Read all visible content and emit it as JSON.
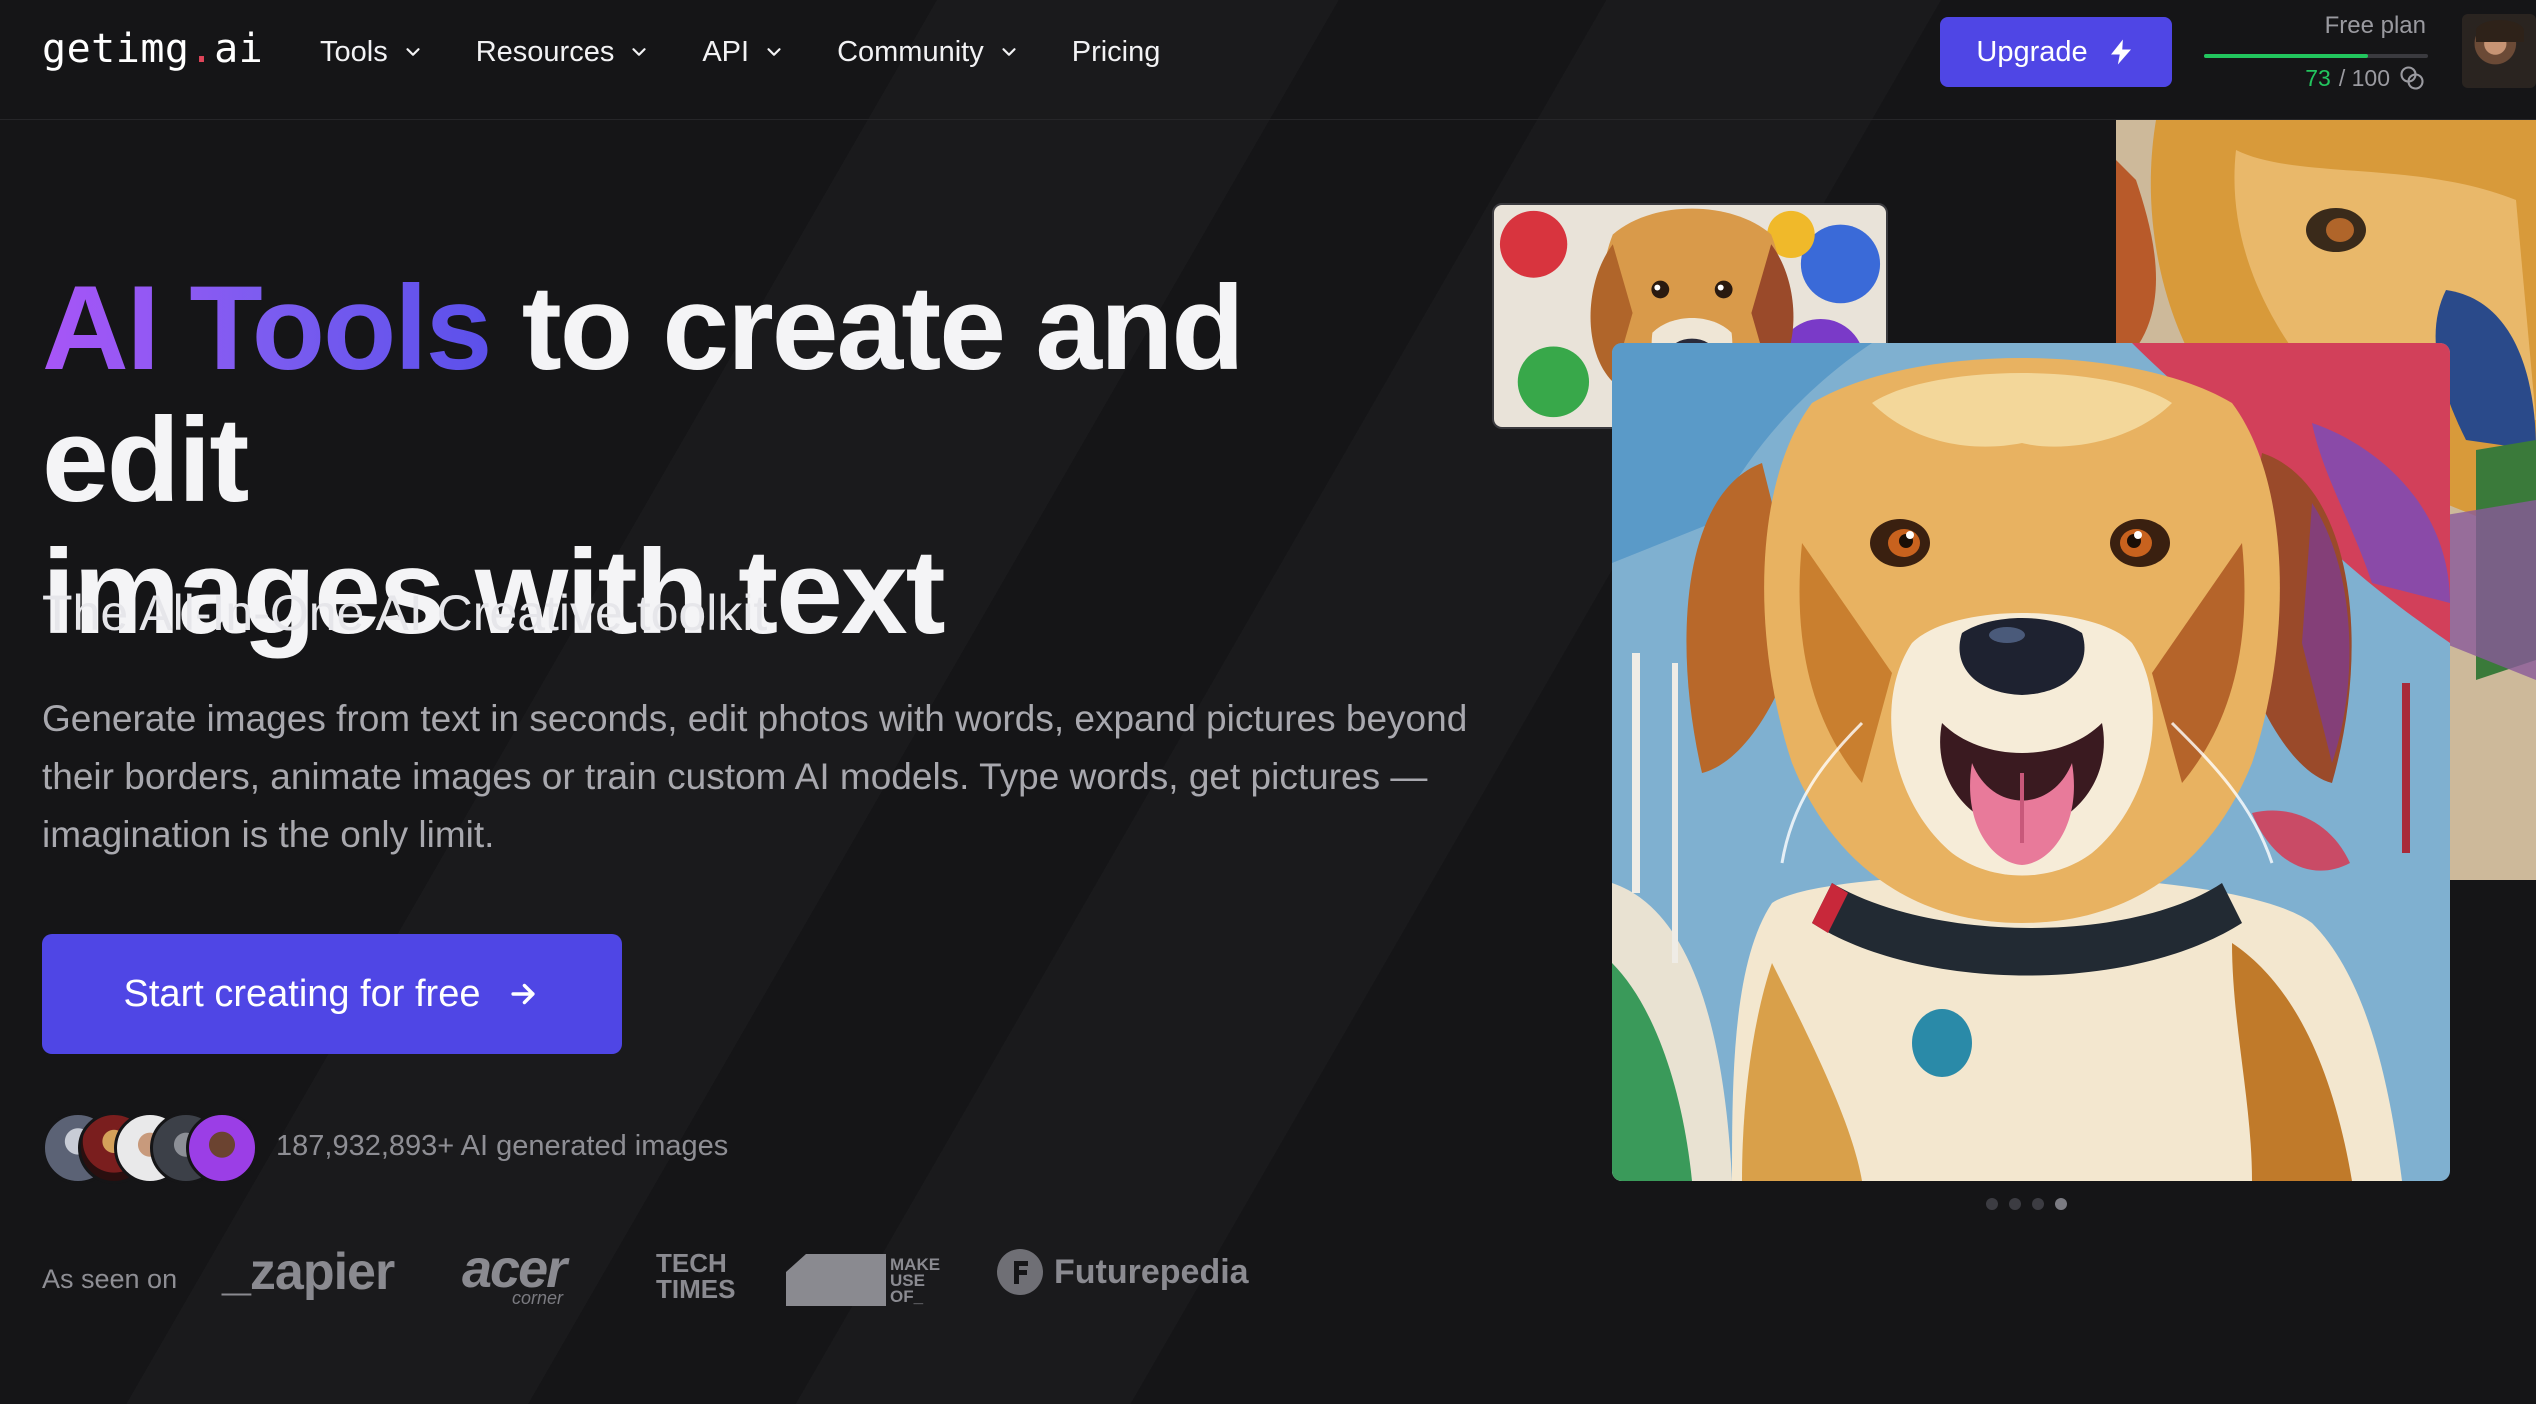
{
  "header": {
    "logo_main": "getimg",
    "logo_dot": ".",
    "logo_tld": "ai",
    "nav": [
      {
        "label": "Tools",
        "has_dropdown": true
      },
      {
        "label": "Resources",
        "has_dropdown": true
      },
      {
        "label": "API",
        "has_dropdown": true
      },
      {
        "label": "Community",
        "has_dropdown": true
      },
      {
        "label": "Pricing",
        "has_dropdown": false
      }
    ],
    "upgrade_label": "Upgrade",
    "upgrade_icon": "lightning-icon",
    "plan": {
      "label": "Free plan",
      "used": "73",
      "total": "/ 100",
      "used_fraction": 0.73,
      "icon": "credits-icon"
    }
  },
  "hero": {
    "title_highlight": "AI Tools",
    "title_rest_line1": "to create and edit",
    "title_line2": "images with text",
    "subtitle": "The All-In-One AI Creative toolkit",
    "description": "Generate images from text in seconds, edit photos with words, expand pictures beyond their borders, animate images or train custom AI models. Type words, get pictures — imagination is the only limit.",
    "cta_label": "Start creating for free",
    "cta_icon": "arrow-right-icon",
    "social_proof": "187,932,893+ AI generated images",
    "as_seen_on": "As seen on",
    "press": [
      {
        "name": "zapier",
        "text": "_zapier"
      },
      {
        "name": "acer",
        "text": "acer",
        "sub": "corner"
      },
      {
        "name": "tech-times",
        "line1": "TECH",
        "line2": "TIMES"
      },
      {
        "name": "make-use-of",
        "line1": "MAKE",
        "line2": "USE",
        "line3": "OF_"
      },
      {
        "name": "futurepedia",
        "text": "Futurepedia"
      }
    ]
  },
  "carousel": {
    "slides": 4,
    "active": 3
  },
  "colors": {
    "background": "#151517",
    "accent": "#4f46e5",
    "gradient_start": "#a855f7",
    "gradient_end": "#5b50ea",
    "progress": "#22c55e"
  }
}
